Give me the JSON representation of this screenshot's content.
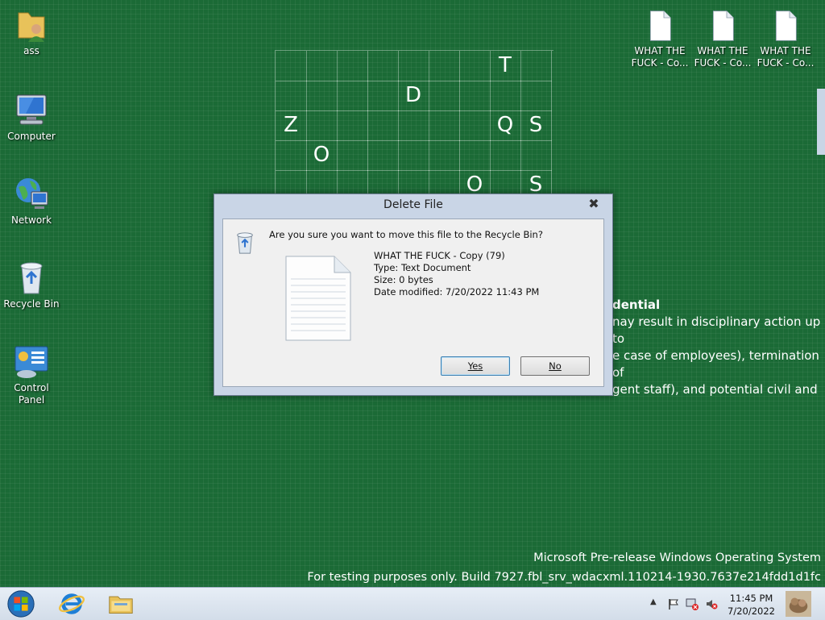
{
  "desktop": {
    "icons": [
      {
        "label": "ass",
        "icon": "user-folder-icon"
      },
      {
        "label": "Computer",
        "icon": "computer-icon"
      },
      {
        "label": "Network",
        "icon": "network-icon"
      },
      {
        "label": "Recycle Bin",
        "icon": "recycle-bin-icon"
      },
      {
        "label": "Control Panel",
        "icon": "control-panel-icon"
      }
    ],
    "files": [
      {
        "label1": "WHAT THE",
        "label2": "FUCK - Co..."
      },
      {
        "label1": "WHAT THE",
        "label2": "FUCK - Co..."
      },
      {
        "label1": "WHAT THE",
        "label2": "FUCK - Co..."
      }
    ],
    "grid_letters": [
      "T",
      "D",
      "Z",
      "Q",
      "S",
      "O",
      "O",
      "S"
    ],
    "background_text": {
      "heading": "dential",
      "line1": "nay result in disciplinary action up to",
      "line2": "e case of employees), termination of",
      "line3": "gent staff), and potential civil and"
    },
    "watermark": {
      "line1": "Microsoft Pre-release Windows Operating System",
      "line2": "For testing purposes only. Build 7927.fbl_srv_wdacxml.110214-1930.7637e214fdd1d1fc"
    }
  },
  "dialog": {
    "title": "Delete File",
    "close": "✖",
    "question": "Are you sure you want to move this file to the Recycle Bin?",
    "file_name": "WHAT THE FUCK - Copy (79)",
    "file_type": "Type: Text Document",
    "file_size": "Size: 0 bytes",
    "file_date": "Date modified: 7/20/2022 11:43 PM",
    "yes_label": "Yes",
    "no_label": "No"
  },
  "taskbar": {
    "time": "11:45 PM",
    "date": "7/20/2022"
  },
  "colors": {
    "desktop": "#1b6a36",
    "dialog_frame": "#c9d5e6"
  }
}
